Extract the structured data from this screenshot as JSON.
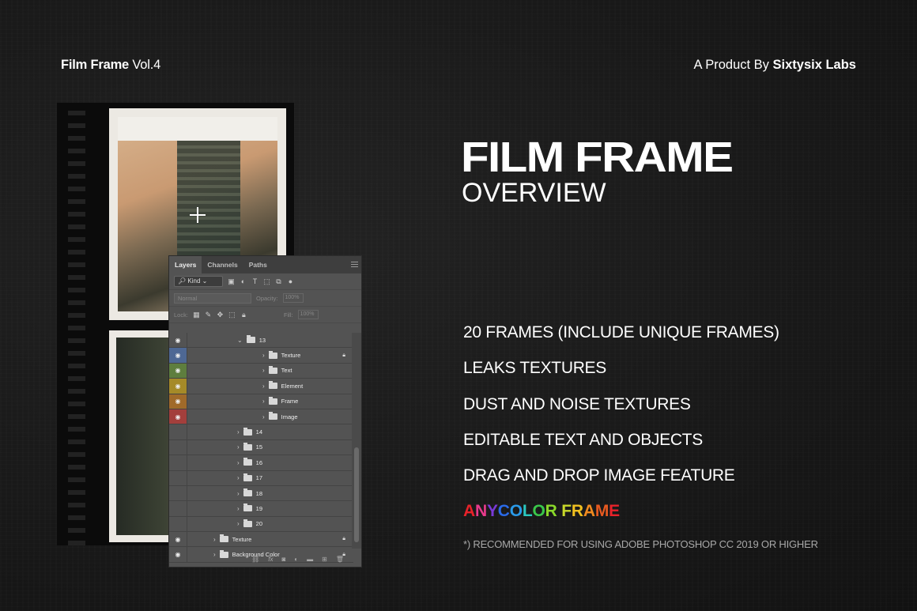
{
  "header": {
    "brand_bold": "Film Frame",
    "brand_rest": " Vol.4",
    "byline_pre": "A Product By ",
    "byline_bold": "Sixtysix Labs"
  },
  "hero": {
    "title": "FILM FRAME",
    "subtitle": "OVERVIEW"
  },
  "features": [
    "20 FRAMES (INCLUDE UNIQUE FRAMES)",
    "LEAKS TEXTURES",
    "DUST AND NOISE TEXTURES",
    "EDITABLE TEXT AND OBJECTS",
    "DRAG AND DROP IMAGE FEATURE"
  ],
  "anycolor": {
    "letters": [
      "A",
      "N",
      "Y",
      "C",
      "O",
      "L",
      "O",
      "R",
      " ",
      "F",
      "R",
      "A",
      "M",
      "E"
    ],
    "colors": [
      "#e8222a",
      "#e83a8c",
      "#7a3ad8",
      "#2a6ae8",
      "#2a9ae8",
      "#2ac8c0",
      "#3ac84a",
      "#8ad82a",
      "#ffffff",
      "#c8d82a",
      "#f0c020",
      "#f08a20",
      "#e85a20",
      "#e8222a"
    ]
  },
  "note": "*) RECOMMENDED FOR USING ADOBE PHOTOSHOP CC 2019 OR HIGHER",
  "panel": {
    "tabs": [
      "Layers",
      "Channels",
      "Paths"
    ],
    "kind_label": "Kind",
    "blend_mode": "Normal",
    "opacity_label": "Opacity:",
    "opacity_value": "100%",
    "lock_label": "Lock:",
    "fill_label": "Fill:",
    "fill_value": "100%",
    "layers": [
      {
        "name": "13",
        "indent": 1,
        "expanded": true,
        "visible": true,
        "color": "",
        "locked": false
      },
      {
        "name": "Texture",
        "indent": 2,
        "expanded": false,
        "visible": true,
        "color": "blue",
        "locked": true
      },
      {
        "name": "Text",
        "indent": 2,
        "expanded": false,
        "visible": true,
        "color": "green",
        "locked": false
      },
      {
        "name": "Element",
        "indent": 2,
        "expanded": false,
        "visible": true,
        "color": "yellow",
        "locked": false
      },
      {
        "name": "Frame",
        "indent": 2,
        "expanded": false,
        "visible": true,
        "color": "orange",
        "locked": false
      },
      {
        "name": "Image",
        "indent": 2,
        "expanded": false,
        "visible": true,
        "color": "red",
        "locked": false
      },
      {
        "name": "14",
        "indent": 1,
        "expanded": false,
        "visible": false,
        "color": "",
        "locked": false
      },
      {
        "name": "15",
        "indent": 1,
        "expanded": false,
        "visible": false,
        "color": "",
        "locked": false
      },
      {
        "name": "16",
        "indent": 1,
        "expanded": false,
        "visible": false,
        "color": "",
        "locked": false
      },
      {
        "name": "17",
        "indent": 1,
        "expanded": false,
        "visible": false,
        "color": "",
        "locked": false
      },
      {
        "name": "18",
        "indent": 1,
        "expanded": false,
        "visible": false,
        "color": "",
        "locked": false
      },
      {
        "name": "19",
        "indent": 1,
        "expanded": false,
        "visible": false,
        "color": "",
        "locked": false
      },
      {
        "name": "20",
        "indent": 1,
        "expanded": false,
        "visible": false,
        "color": "",
        "locked": false
      },
      {
        "name": "Texture",
        "indent": 0,
        "expanded": false,
        "visible": true,
        "color": "",
        "locked": true
      },
      {
        "name": "Background Color",
        "indent": 0,
        "expanded": false,
        "visible": true,
        "color": "",
        "locked": true
      }
    ]
  }
}
